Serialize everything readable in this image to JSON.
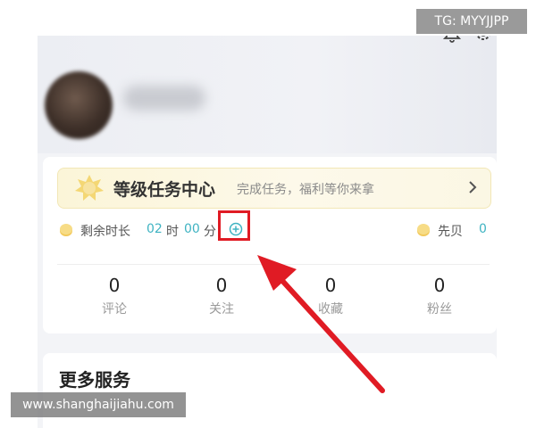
{
  "watermark_top": "TG: MYYJJPP",
  "watermark_bottom": "www.shanghaijiahu.com",
  "banner": {
    "title": "等级任务中心",
    "subtitle": "完成任务，福利等你来拿"
  },
  "time_row": {
    "label": "剩余时长",
    "hours": "02",
    "hours_unit": "时",
    "minutes": "00",
    "minutes_unit": "分",
    "xianbei_label": "先贝",
    "xianbei_value": "0"
  },
  "stats": [
    {
      "value": "0",
      "label": "评论"
    },
    {
      "value": "0",
      "label": "关注"
    },
    {
      "value": "0",
      "label": "收藏"
    },
    {
      "value": "0",
      "label": "粉丝"
    }
  ],
  "more_services_title": "更多服务",
  "colors": {
    "accent_teal": "#3fb3c2",
    "highlight_red": "#e01b24",
    "banner_bg": "#fbf5d8"
  },
  "icons": [
    "bell-icon",
    "gear-icon",
    "sun-icon",
    "chevron-right-icon",
    "coin-icon",
    "plus-circle-icon"
  ]
}
